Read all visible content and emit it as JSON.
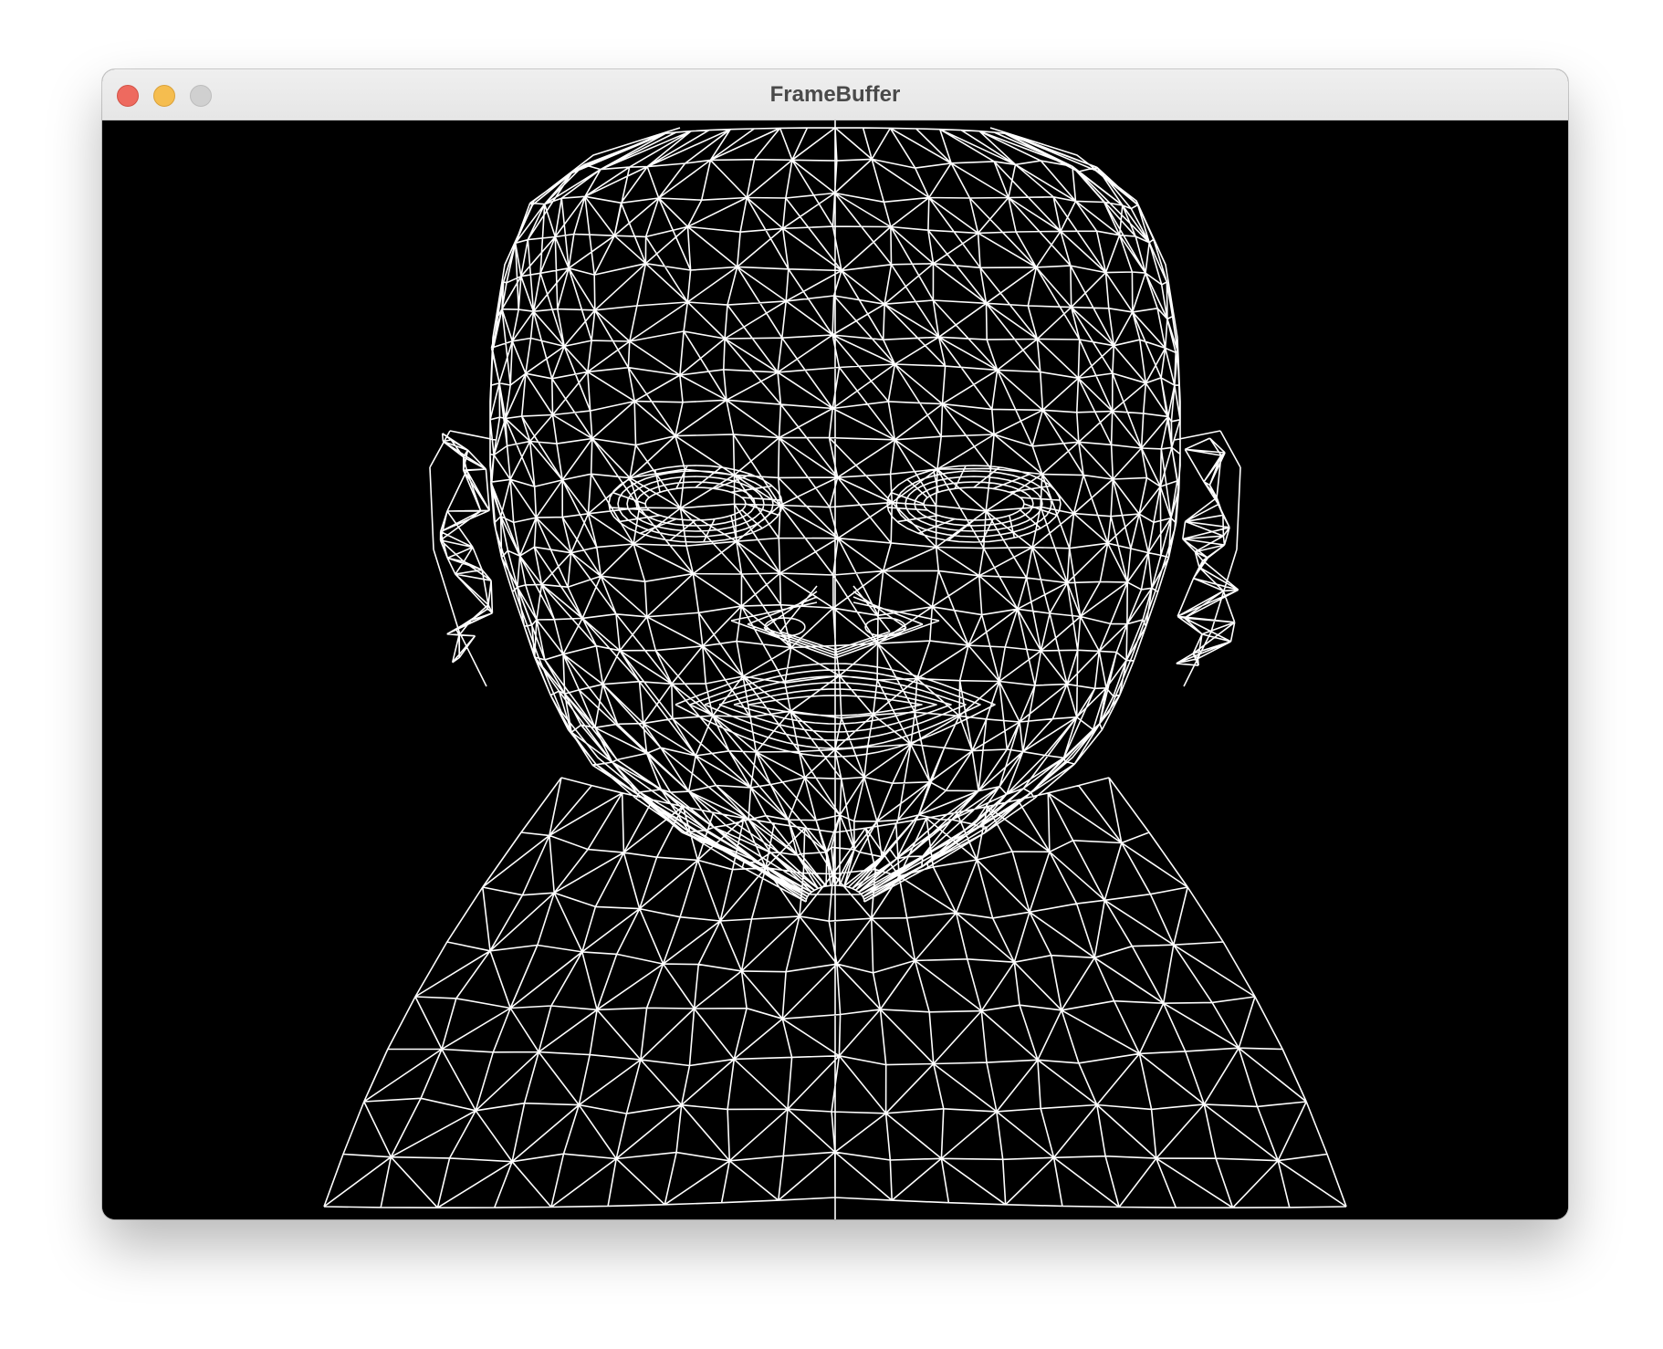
{
  "window": {
    "title": "FrameBuffer",
    "controls": {
      "close_color": "#ee6a5f",
      "minimize_color": "#f5bd4f",
      "zoom_color": "#d0d0d0"
    }
  },
  "viewport": {
    "background_color": "#000000",
    "wire_color": "#ffffff",
    "content": "wireframe-head-mesh"
  }
}
